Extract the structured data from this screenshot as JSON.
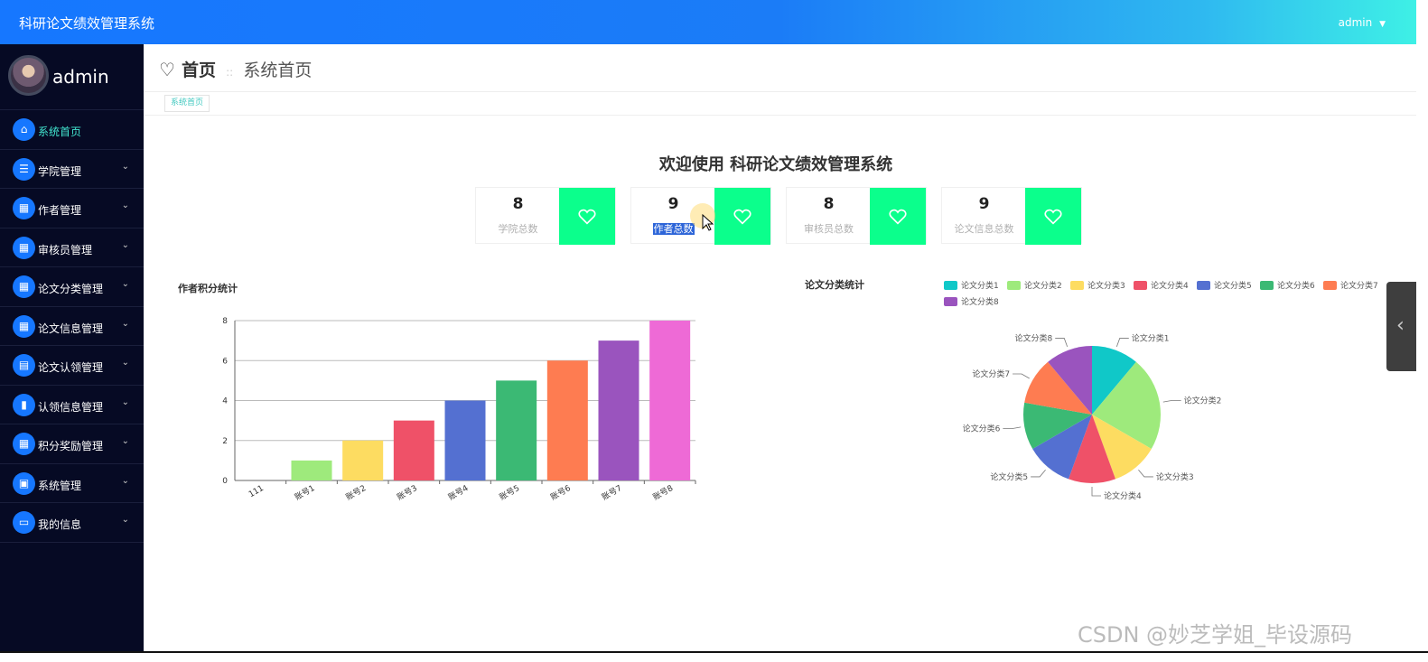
{
  "header": {
    "app_title": "科研论文绩效管理系统",
    "user": "admin",
    "caret": "▼"
  },
  "sidebar": {
    "username": "admin",
    "items": [
      {
        "label": "系统首页",
        "icon": "home-icon",
        "glyph": "⌂",
        "active": true
      },
      {
        "label": "学院管理",
        "icon": "list-icon",
        "glyph": "☰"
      },
      {
        "label": "作者管理",
        "icon": "grid-icon",
        "glyph": "▦"
      },
      {
        "label": "审核员管理",
        "icon": "grid-icon",
        "glyph": "▦"
      },
      {
        "label": "论文分类管理",
        "icon": "grid-icon",
        "glyph": "▦"
      },
      {
        "label": "论文信息管理",
        "icon": "grid-icon",
        "glyph": "▦"
      },
      {
        "label": "论文认领管理",
        "icon": "chat-icon",
        "glyph": "▤"
      },
      {
        "label": "认领信息管理",
        "icon": "bar-chart-icon",
        "glyph": "▮"
      },
      {
        "label": "积分奖励管理",
        "icon": "grid-icon",
        "glyph": "▦"
      },
      {
        "label": "系统管理",
        "icon": "briefcase-icon",
        "glyph": "▣"
      },
      {
        "label": "我的信息",
        "icon": "card-icon",
        "glyph": "▭"
      }
    ]
  },
  "page": {
    "title": "首页",
    "subtitle": "系统首页",
    "tab": "系统首页",
    "welcome": "欢迎使用 科研论文绩效管理系统"
  },
  "stats": [
    {
      "value": "8",
      "label": "学院总数"
    },
    {
      "value": "9",
      "label": "作者总数"
    },
    {
      "value": "8",
      "label": "审核员总数"
    },
    {
      "value": "9",
      "label": "论文信息总数"
    }
  ],
  "colors": {
    "accent": "#1677ff",
    "stat_box": "#0bff8c",
    "sidebar_bg": "#060a24",
    "active_text": "#42e6d0"
  },
  "chart_data": [
    {
      "type": "bar",
      "title": "作者积分统计",
      "categories": [
        "111",
        "账号1",
        "账号2",
        "账号3",
        "账号4",
        "账号5",
        "账号6",
        "账号7",
        "账号8"
      ],
      "values": [
        0,
        1,
        2,
        3,
        4,
        5,
        6,
        7,
        8
      ],
      "colors": [
        "#5470c6",
        "#9eea7c",
        "#fddc61",
        "#ef5168",
        "#5470d1",
        "#3bb974",
        "#fe7c51",
        "#9a54be",
        "#ee6ad6"
      ],
      "ylim": [
        0,
        8
      ],
      "yticks": [
        0,
        2,
        4,
        6,
        8
      ],
      "grid": true
    },
    {
      "type": "pie",
      "title": "论文分类统计",
      "legend": "top",
      "slices": [
        {
          "name": "论文分类1",
          "value": 1,
          "color": "#10c8c8"
        },
        {
          "name": "论文分类2",
          "value": 2,
          "color": "#9eea7c"
        },
        {
          "name": "论文分类3",
          "value": 1,
          "color": "#fddc61"
        },
        {
          "name": "论文分类4",
          "value": 1,
          "color": "#ef5168"
        },
        {
          "name": "论文分类5",
          "value": 1,
          "color": "#5470d1"
        },
        {
          "name": "论文分类6",
          "value": 1,
          "color": "#3bb974"
        },
        {
          "name": "论文分类7",
          "value": 1,
          "color": "#fe7c51"
        },
        {
          "name": "论文分类8",
          "value": 1,
          "color": "#9a54be"
        }
      ]
    }
  ],
  "watermark": "CSDN @妙芝学姐_毕设源码"
}
